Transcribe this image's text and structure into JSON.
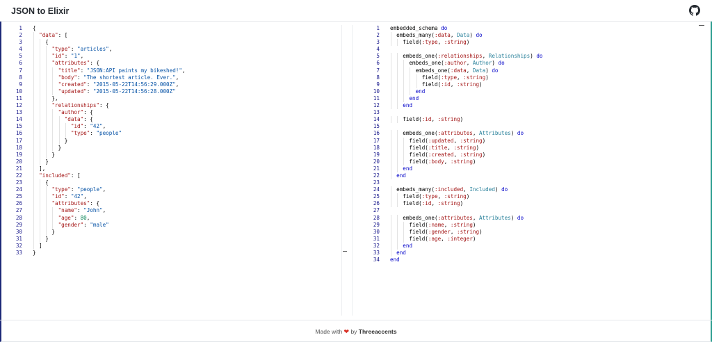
{
  "header": {
    "title": "JSON to Elixir",
    "github_icon": "github-icon"
  },
  "left_editor": {
    "lines": [
      [
        [
          "p",
          "{"
        ]
      ],
      [
        [
          "p",
          "  "
        ],
        [
          "key",
          "\"data\""
        ],
        [
          "p",
          ": ["
        ]
      ],
      [
        [
          "p",
          "    {"
        ]
      ],
      [
        [
          "p",
          "      "
        ],
        [
          "key",
          "\"type\""
        ],
        [
          "p",
          ": "
        ],
        [
          "str",
          "\"articles\""
        ],
        [
          "p",
          ","
        ]
      ],
      [
        [
          "p",
          "      "
        ],
        [
          "key",
          "\"id\""
        ],
        [
          "p",
          ": "
        ],
        [
          "str",
          "\"1\""
        ],
        [
          "p",
          ","
        ]
      ],
      [
        [
          "p",
          "      "
        ],
        [
          "key",
          "\"attributes\""
        ],
        [
          "p",
          ": {"
        ]
      ],
      [
        [
          "p",
          "        "
        ],
        [
          "key",
          "\"title\""
        ],
        [
          "p",
          ": "
        ],
        [
          "str",
          "\"JSON:API paints my bikeshed!\""
        ],
        [
          "p",
          ","
        ]
      ],
      [
        [
          "p",
          "        "
        ],
        [
          "key",
          "\"body\""
        ],
        [
          "p",
          ": "
        ],
        [
          "str",
          "\"The shortest article. Ever.\""
        ],
        [
          "p",
          ","
        ]
      ],
      [
        [
          "p",
          "        "
        ],
        [
          "key",
          "\"created\""
        ],
        [
          "p",
          ": "
        ],
        [
          "str",
          "\"2015-05-22T14:56:29.000Z\""
        ],
        [
          "p",
          ","
        ]
      ],
      [
        [
          "p",
          "        "
        ],
        [
          "key",
          "\"updated\""
        ],
        [
          "p",
          ": "
        ],
        [
          "str",
          "\"2015-05-22T14:56:28.000Z\""
        ]
      ],
      [
        [
          "p",
          "      },"
        ]
      ],
      [
        [
          "p",
          "      "
        ],
        [
          "key",
          "\"relationships\""
        ],
        [
          "p",
          ": {"
        ]
      ],
      [
        [
          "p",
          "        "
        ],
        [
          "key",
          "\"author\""
        ],
        [
          "p",
          ": {"
        ]
      ],
      [
        [
          "p",
          "          "
        ],
        [
          "key",
          "\"data\""
        ],
        [
          "p",
          ": {"
        ]
      ],
      [
        [
          "p",
          "            "
        ],
        [
          "key",
          "\"id\""
        ],
        [
          "p",
          ": "
        ],
        [
          "str",
          "\"42\""
        ],
        [
          "p",
          ","
        ]
      ],
      [
        [
          "p",
          "            "
        ],
        [
          "key",
          "\"type\""
        ],
        [
          "p",
          ": "
        ],
        [
          "str",
          "\"people\""
        ]
      ],
      [
        [
          "p",
          "          }"
        ]
      ],
      [
        [
          "p",
          "        }"
        ]
      ],
      [
        [
          "p",
          "      }"
        ]
      ],
      [
        [
          "p",
          "    }"
        ]
      ],
      [
        [
          "p",
          "  ],"
        ]
      ],
      [
        [
          "p",
          "  "
        ],
        [
          "key",
          "\"included\""
        ],
        [
          "p",
          ": ["
        ]
      ],
      [
        [
          "p",
          "    {"
        ]
      ],
      [
        [
          "p",
          "      "
        ],
        [
          "key",
          "\"type\""
        ],
        [
          "p",
          ": "
        ],
        [
          "str",
          "\"people\""
        ],
        [
          "p",
          ","
        ]
      ],
      [
        [
          "p",
          "      "
        ],
        [
          "key",
          "\"id\""
        ],
        [
          "p",
          ": "
        ],
        [
          "str",
          "\"42\""
        ],
        [
          "p",
          ","
        ]
      ],
      [
        [
          "p",
          "      "
        ],
        [
          "key",
          "\"attributes\""
        ],
        [
          "p",
          ": {"
        ]
      ],
      [
        [
          "p",
          "        "
        ],
        [
          "key",
          "\"name\""
        ],
        [
          "p",
          ": "
        ],
        [
          "str",
          "\"John\""
        ],
        [
          "p",
          ","
        ]
      ],
      [
        [
          "p",
          "        "
        ],
        [
          "key",
          "\"age\""
        ],
        [
          "p",
          ": "
        ],
        [
          "num",
          "80"
        ],
        [
          "p",
          ","
        ]
      ],
      [
        [
          "p",
          "        "
        ],
        [
          "key",
          "\"gender\""
        ],
        [
          "p",
          ": "
        ],
        [
          "str",
          "\"male\""
        ]
      ],
      [
        [
          "p",
          "      }"
        ]
      ],
      [
        [
          "p",
          "    }"
        ]
      ],
      [
        [
          "p",
          "  ]"
        ]
      ],
      [
        [
          "p",
          "}"
        ]
      ]
    ]
  },
  "right_editor": {
    "lines": [
      [
        [
          "p",
          "embedded_schema "
        ],
        [
          "kw",
          "do"
        ]
      ],
      [
        [
          "p",
          "  embeds_many("
        ],
        [
          "atom",
          ":data"
        ],
        [
          "p",
          ", "
        ],
        [
          "mod",
          "Data"
        ],
        [
          "p",
          ") "
        ],
        [
          "kw",
          "do"
        ]
      ],
      [
        [
          "p",
          "    field("
        ],
        [
          "atom",
          ":type"
        ],
        [
          "p",
          ", "
        ],
        [
          "atom",
          ":string"
        ],
        [
          "p",
          ")"
        ]
      ],
      [
        [
          "p",
          ""
        ]
      ],
      [
        [
          "p",
          "    embeds_one("
        ],
        [
          "atom",
          ":relationships"
        ],
        [
          "p",
          ", "
        ],
        [
          "mod",
          "Relationships"
        ],
        [
          "p",
          ") "
        ],
        [
          "kw",
          "do"
        ]
      ],
      [
        [
          "p",
          "      embeds_one("
        ],
        [
          "atom",
          ":author"
        ],
        [
          "p",
          ", "
        ],
        [
          "mod",
          "Author"
        ],
        [
          "p",
          ") "
        ],
        [
          "kw",
          "do"
        ]
      ],
      [
        [
          "p",
          "        embeds_one("
        ],
        [
          "atom",
          ":data"
        ],
        [
          "p",
          ", "
        ],
        [
          "mod",
          "Data"
        ],
        [
          "p",
          ") "
        ],
        [
          "kw",
          "do"
        ]
      ],
      [
        [
          "p",
          "          field("
        ],
        [
          "atom",
          ":type"
        ],
        [
          "p",
          ", "
        ],
        [
          "atom",
          ":string"
        ],
        [
          "p",
          ")"
        ]
      ],
      [
        [
          "p",
          "          field("
        ],
        [
          "atom",
          ":id"
        ],
        [
          "p",
          ", "
        ],
        [
          "atom",
          ":string"
        ],
        [
          "p",
          ")"
        ]
      ],
      [
        [
          "p",
          "        "
        ],
        [
          "kw",
          "end"
        ]
      ],
      [
        [
          "p",
          "      "
        ],
        [
          "kw",
          "end"
        ]
      ],
      [
        [
          "p",
          "    "
        ],
        [
          "kw",
          "end"
        ]
      ],
      [
        [
          "p",
          ""
        ]
      ],
      [
        [
          "p",
          "    field("
        ],
        [
          "atom",
          ":id"
        ],
        [
          "p",
          ", "
        ],
        [
          "atom",
          ":string"
        ],
        [
          "p",
          ")"
        ]
      ],
      [
        [
          "p",
          ""
        ]
      ],
      [
        [
          "p",
          "    embeds_one("
        ],
        [
          "atom",
          ":attributes"
        ],
        [
          "p",
          ", "
        ],
        [
          "mod",
          "Attributes"
        ],
        [
          "p",
          ") "
        ],
        [
          "kw",
          "do"
        ]
      ],
      [
        [
          "p",
          "      field("
        ],
        [
          "atom",
          ":updated"
        ],
        [
          "p",
          ", "
        ],
        [
          "atom",
          ":string"
        ],
        [
          "p",
          ")"
        ]
      ],
      [
        [
          "p",
          "      field("
        ],
        [
          "atom",
          ":title"
        ],
        [
          "p",
          ", "
        ],
        [
          "atom",
          ":string"
        ],
        [
          "p",
          ")"
        ]
      ],
      [
        [
          "p",
          "      field("
        ],
        [
          "atom",
          ":created"
        ],
        [
          "p",
          ", "
        ],
        [
          "atom",
          ":string"
        ],
        [
          "p",
          ")"
        ]
      ],
      [
        [
          "p",
          "      field("
        ],
        [
          "atom",
          ":body"
        ],
        [
          "p",
          ", "
        ],
        [
          "atom",
          ":string"
        ],
        [
          "p",
          ")"
        ]
      ],
      [
        [
          "p",
          "    "
        ],
        [
          "kw",
          "end"
        ]
      ],
      [
        [
          "p",
          "  "
        ],
        [
          "kw",
          "end"
        ]
      ],
      [
        [
          "p",
          ""
        ]
      ],
      [
        [
          "p",
          "  embeds_many("
        ],
        [
          "atom",
          ":included"
        ],
        [
          "p",
          ", "
        ],
        [
          "mod",
          "Included"
        ],
        [
          "p",
          ") "
        ],
        [
          "kw",
          "do"
        ]
      ],
      [
        [
          "p",
          "    field("
        ],
        [
          "atom",
          ":type"
        ],
        [
          "p",
          ", "
        ],
        [
          "atom",
          ":string"
        ],
        [
          "p",
          ")"
        ]
      ],
      [
        [
          "p",
          "    field("
        ],
        [
          "atom",
          ":id"
        ],
        [
          "p",
          ", "
        ],
        [
          "atom",
          ":string"
        ],
        [
          "p",
          ")"
        ]
      ],
      [
        [
          "p",
          ""
        ]
      ],
      [
        [
          "p",
          "    embeds_one("
        ],
        [
          "atom",
          ":attributes"
        ],
        [
          "p",
          ", "
        ],
        [
          "mod",
          "Attributes"
        ],
        [
          "p",
          ") "
        ],
        [
          "kw",
          "do"
        ]
      ],
      [
        [
          "p",
          "      field("
        ],
        [
          "atom",
          ":name"
        ],
        [
          "p",
          ", "
        ],
        [
          "atom",
          ":string"
        ],
        [
          "p",
          ")"
        ]
      ],
      [
        [
          "p",
          "      field("
        ],
        [
          "atom",
          ":gender"
        ],
        [
          "p",
          ", "
        ],
        [
          "atom",
          ":string"
        ],
        [
          "p",
          ")"
        ]
      ],
      [
        [
          "p",
          "      field("
        ],
        [
          "atom",
          ":age"
        ],
        [
          "p",
          ", "
        ],
        [
          "atom",
          ":integer"
        ],
        [
          "p",
          ")"
        ]
      ],
      [
        [
          "p",
          "    "
        ],
        [
          "kw",
          "end"
        ]
      ],
      [
        [
          "p",
          "  "
        ],
        [
          "kw",
          "end"
        ]
      ],
      [
        [
          "p",
          ""
        ],
        [
          "kw",
          "end"
        ]
      ]
    ]
  },
  "footer": {
    "prefix": "Made with",
    "heart": "❤",
    "by": "by",
    "author": "Threeaccents"
  }
}
